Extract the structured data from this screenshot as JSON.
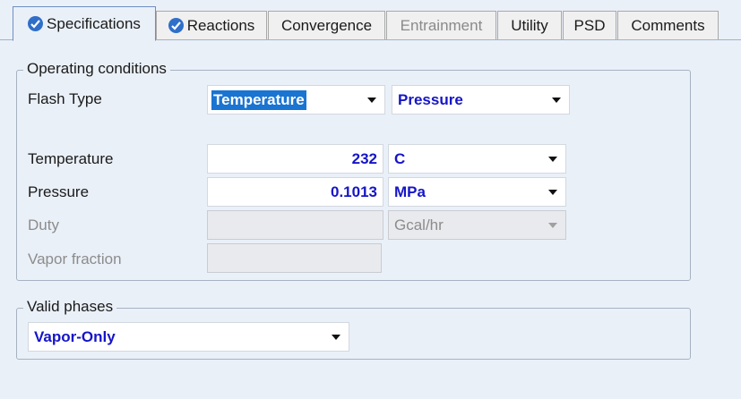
{
  "tabs": [
    {
      "label": "Specifications",
      "state": "active",
      "icon": "check-circle-icon"
    },
    {
      "label": "Reactions",
      "state": "normal",
      "icon": "check-circle-icon"
    },
    {
      "label": "Convergence",
      "state": "normal"
    },
    {
      "label": "Entrainment",
      "state": "disabled"
    },
    {
      "label": "Utility",
      "state": "normal"
    },
    {
      "label": "PSD",
      "state": "normal"
    },
    {
      "label": "Comments",
      "state": "normal"
    }
  ],
  "operating_conditions": {
    "legend": "Operating conditions",
    "flash_type_label": "Flash Type",
    "flash_type_value1": "Temperature",
    "flash_type_value2": "Pressure",
    "temperature_label": "Temperature",
    "temperature_value": "232",
    "temperature_unit": "C",
    "pressure_label": "Pressure",
    "pressure_value": "0.1013",
    "pressure_unit": "MPa",
    "duty_label": "Duty",
    "duty_value": "",
    "duty_unit": "Gcal/hr",
    "vapor_fraction_label": "Vapor fraction",
    "vapor_fraction_value": ""
  },
  "valid_phases": {
    "legend": "Valid phases",
    "value": "Vapor-Only"
  },
  "colors": {
    "accent": "#2f6fc9",
    "value_text": "#1515c8",
    "selection": "#1a74d1",
    "background": "#eaf0f8"
  }
}
